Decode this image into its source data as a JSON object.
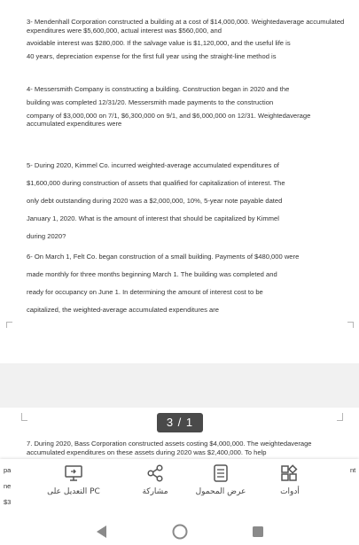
{
  "questions": [
    {
      "lines": [
        "3- Mendenhall Corporation constructed a building at a cost of $14,000,000. Weightedaverage accumulated expenditures were $5,600,000, actual interest was $560,000, and",
        "avoidable interest was $280,000. If the salvage value is $1,120,000, and the useful life is",
        "40 years, depreciation expense for the first full year using the straight-line method is"
      ]
    },
    {
      "lines": [
        "4- Messersmith Company is constructing a building. Construction began in 2020 and the",
        "building was completed 12/31/20. Messersmith made payments to the construction",
        "company of $3,000,000 on 7/1, $6,300,000 on 9/1, and $6,000,000 on 12/31. Weightedaverage accumulated expenditures were"
      ]
    },
    {
      "lines": [
        "5- During 2020, Kimmel Co. incurred weighted-average accumulated expenditures of",
        "$1,600,000 during construction of assets that qualified for capitalization of interest. The",
        "only debt outstanding during 2020 was a $2,000,000, 10%, 5-year note payable dated",
        "January 1, 2020. What is the amount of interest that should be capitalized by Kimmel",
        "during 2020?"
      ]
    },
    {
      "lines": [
        "6- On March 1, Felt Co. began construction of a small building. Payments of $480,000 were",
        "made monthly for three months beginning March 1. The building was completed and",
        "ready for occupancy on June 1. In determining the amount of interest cost to be",
        "capitalized, the weighted-average accumulated expenditures are"
      ]
    }
  ],
  "page_indicator": "3 / 1",
  "question7": "7. During 2020, Bass Corporation constructed assets costing $4,000,000. The weightedaverage accumulated expenditures on these assets during 2020 was $2,400,000. To help",
  "peek_text": {
    "left1": "pa",
    "left2": "ne",
    "left3": "$3",
    "right1": "nt"
  },
  "toolbar": {
    "edit_pc": "التعديل على PC",
    "share": "مشاركة",
    "view_mode": "عرض المحمول",
    "tools": "أدوات"
  }
}
